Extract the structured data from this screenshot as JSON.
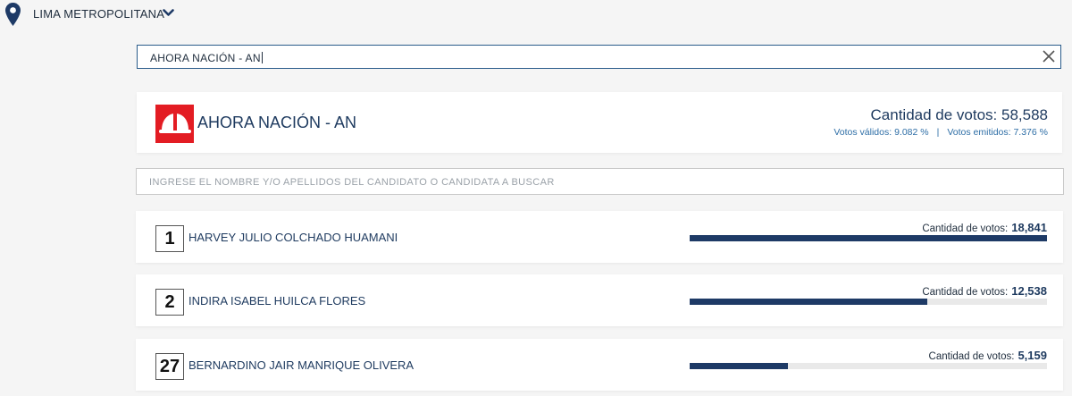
{
  "region": {
    "label": "LIMA METROPOLITANA",
    "pin_icon": "location-pin-icon",
    "toggle_icon": "chevron-down-icon"
  },
  "party_search": {
    "value": "AHORA NACIÓN - AN",
    "clear_icon": "close-icon"
  },
  "party": {
    "name": "AHORA NACIÓN - AN",
    "votes_label": "Cantidad de votos: 58,588",
    "valid_label": "Votos válidos: 9.082 %",
    "emitted_label": "Votos emitidos: 7.376 %",
    "brand_color": "#e31c23"
  },
  "candidate_search": {
    "placeholder": "INGRESE EL NOMBRE Y/O APELLIDOS DEL CANDIDATO O CANDIDATA A BUSCAR"
  },
  "candidates": [
    {
      "number": "1",
      "name": "HARVEY JULIO COLCHADO HUAMANI",
      "votes_label": "Cantidad de votos:",
      "votes": "18,841",
      "share": 1.0
    },
    {
      "number": "2",
      "name": "INDIRA ISABEL HUILCA FLORES",
      "votes_label": "Cantidad de votos:",
      "votes": "12,538",
      "share": 0.665
    },
    {
      "number": "27",
      "name": "BERNARDINO JAIR MANRIQUE OLIVERA",
      "votes_label": "Cantidad de votos:",
      "votes": "5,159",
      "share": 0.274
    }
  ],
  "colors": {
    "primary": "#1e3a5f",
    "bar": "#1e3a66",
    "accent_link": "#2e6ea6"
  }
}
